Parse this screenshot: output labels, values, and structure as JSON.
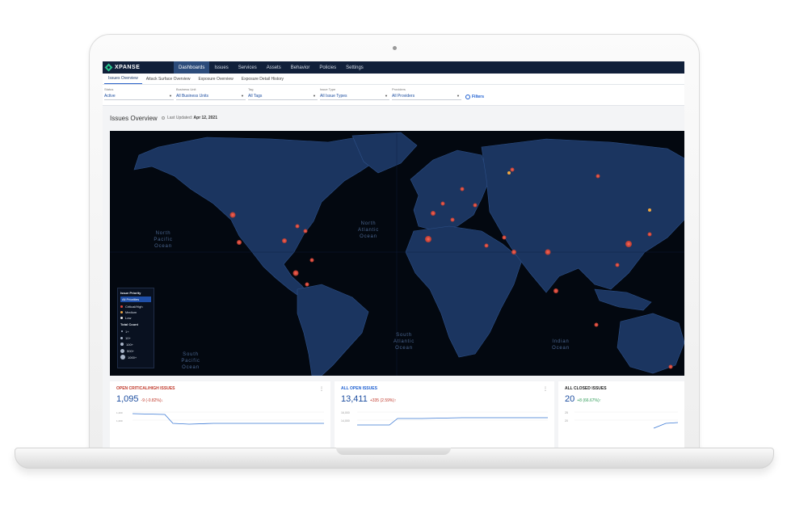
{
  "app": {
    "name": "XPANSE"
  },
  "nav": [
    "Dashboards",
    "Issues",
    "Services",
    "Assets",
    "Behavior",
    "Policies",
    "Settings"
  ],
  "nav_active": 0,
  "subtabs": [
    "Issues Overview",
    "Attack Surface Overview",
    "Exposure Overview",
    "Exposure Detail History"
  ],
  "subtab_active": 0,
  "filters": [
    {
      "label": "Status",
      "value": "Active"
    },
    {
      "label": "Business Unit",
      "value": "All Business Units"
    },
    {
      "label": "Tag",
      "value": "All Tags"
    },
    {
      "label": "Issue Type",
      "value": "All Issue Types"
    },
    {
      "label": "Providers",
      "value": "All Providers"
    }
  ],
  "filters_button": "Filters",
  "page": {
    "title": "Issues Overview",
    "updated_label": "Last Updated:",
    "updated_value": "Apr 12, 2021"
  },
  "map": {
    "oceans": [
      {
        "lines": [
          "North",
          "Pacific",
          "Ocean"
        ]
      },
      {
        "lines": [
          "North",
          "Atlantic",
          "Ocean"
        ]
      },
      {
        "lines": [
          "South",
          "Atlantic",
          "Ocean"
        ]
      },
      {
        "lines": [
          "South",
          "Pacific",
          "Ocean"
        ]
      },
      {
        "lines": [
          "Indian",
          "Ocean"
        ]
      }
    ],
    "marker_color": "#e0443a",
    "legend": {
      "priority_title": "Issue Priority",
      "selected": "All Priorities",
      "items": [
        {
          "label": "Critical/High",
          "color": "#e0443a"
        },
        {
          "label": "Medium",
          "color": "#f0a640"
        },
        {
          "label": "Low",
          "color": "#e6e6e6"
        }
      ],
      "count_title": "Total Count",
      "counts": [
        "1+",
        "10+",
        "100+",
        "500+",
        "1000+"
      ]
    }
  },
  "cards": [
    {
      "title": "OPEN CRITICAL/HIGH ISSUES",
      "title_color": "#c0392b",
      "value": "1,095",
      "delta": "-9 (-0.82%)↓",
      "delta_color": "#c0392b",
      "axis": [
        "1,400",
        "1,200"
      ]
    },
    {
      "title": "ALL OPEN ISSUES",
      "title_color": "#1d5fd1",
      "value": "13,411",
      "delta": "+335 (2.59%)↑",
      "delta_color": "#c0392b",
      "axis": [
        "16,000",
        "14,000"
      ]
    },
    {
      "title": "ALL CLOSED ISSUES",
      "title_color": "#222222",
      "value": "20",
      "delta": "+8 (66.67%)↑",
      "delta_color": "#2e9b57",
      "axis": [
        "25",
        "20"
      ]
    }
  ]
}
